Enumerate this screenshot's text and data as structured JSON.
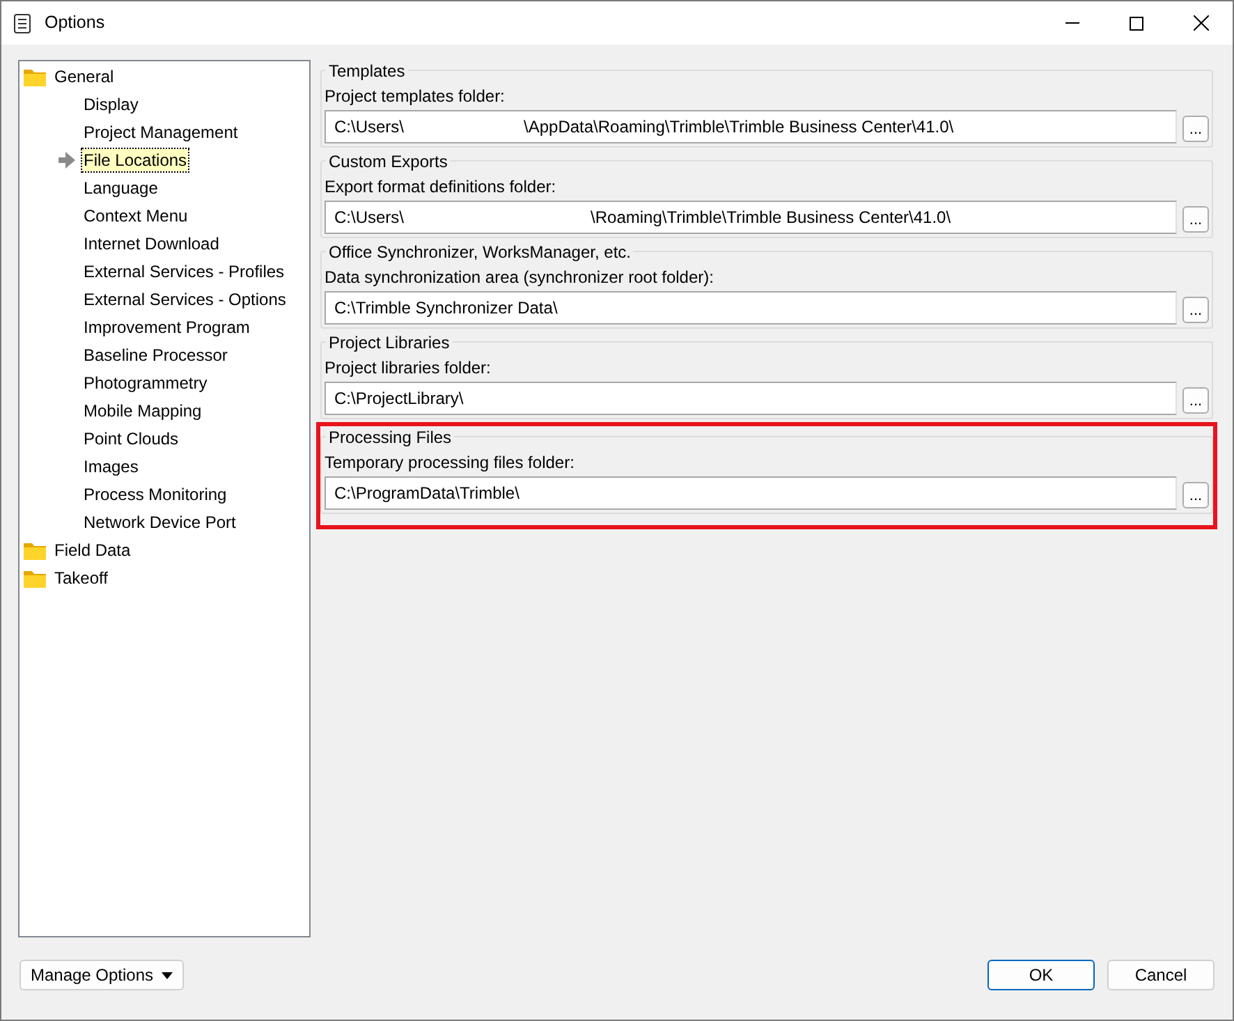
{
  "window": {
    "title": "Options"
  },
  "tree": [
    {
      "label": "General",
      "kind": "folder",
      "selected": false,
      "children": [
        {
          "label": "Display",
          "selected": false
        },
        {
          "label": "Project Management",
          "selected": false
        },
        {
          "label": "File Locations",
          "selected": true
        },
        {
          "label": "Language",
          "selected": false
        },
        {
          "label": "Context Menu",
          "selected": false
        },
        {
          "label": "Internet Download",
          "selected": false
        },
        {
          "label": "External Services - Profiles",
          "selected": false
        },
        {
          "label": "External Services - Options",
          "selected": false
        },
        {
          "label": "Improvement Program",
          "selected": false
        },
        {
          "label": "Baseline Processor",
          "selected": false
        },
        {
          "label": "Photogrammetry",
          "selected": false
        },
        {
          "label": "Mobile Mapping",
          "selected": false
        },
        {
          "label": "Point Clouds",
          "selected": false
        },
        {
          "label": "Images",
          "selected": false
        },
        {
          "label": "Process Monitoring",
          "selected": false
        },
        {
          "label": "Network Device Port",
          "selected": false
        }
      ]
    },
    {
      "label": "Field Data",
      "kind": "folder",
      "selected": false
    },
    {
      "label": "Takeoff",
      "kind": "folder",
      "selected": false
    }
  ],
  "groups": [
    {
      "title": "Templates",
      "label": "Project templates folder:",
      "value_parts": [
        "C:\\Users\\",
        "\\AppData\\Roaming\\Trimble\\Trimble Business Center\\41.0\\"
      ],
      "browse": "...",
      "highlighted": false
    },
    {
      "title": "Custom Exports",
      "label": "Export format definitions folder:",
      "value_parts": [
        "C:\\Users\\",
        "\\Roaming\\Trimble\\Trimble Business Center\\41.0\\"
      ],
      "browse": "...",
      "highlighted": false
    },
    {
      "title": "Office Synchronizer, WorksManager, etc.",
      "label": "Data synchronization area (synchronizer root folder):",
      "value_parts": [
        "C:\\Trimble Synchronizer Data\\"
      ],
      "browse": "...",
      "highlighted": false
    },
    {
      "title": "Project Libraries",
      "label": "Project libraries folder:",
      "value_parts": [
        "C:\\ProjectLibrary\\"
      ],
      "browse": "...",
      "highlighted": false
    },
    {
      "title": "Processing Files",
      "label": "Temporary processing files folder:",
      "value_parts": [
        "C:\\ProgramData\\Trimble\\"
      ],
      "browse": "...",
      "highlighted": true
    }
  ],
  "footer": {
    "manage": "Manage Options",
    "ok": "OK",
    "cancel": "Cancel"
  }
}
